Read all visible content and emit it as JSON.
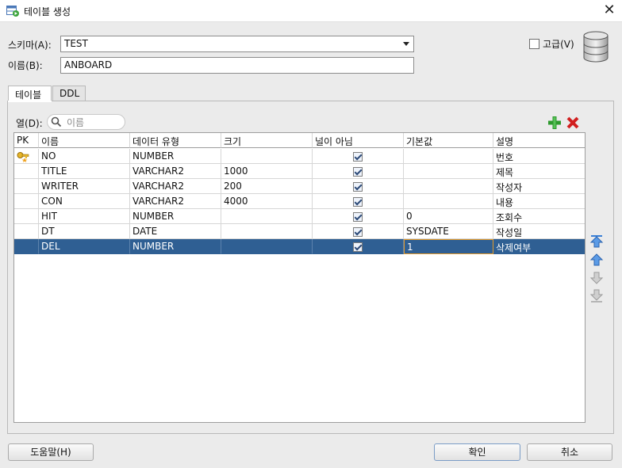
{
  "window": {
    "title": "테이블 생성",
    "close_glyph": "✕"
  },
  "schema": {
    "label": "스키마(A):",
    "value": "TEST"
  },
  "name": {
    "label": "이름(B):",
    "value": "ANBOARD"
  },
  "advanced": {
    "label": "고급(V)",
    "checked": false
  },
  "tabs": [
    {
      "label": "테이블"
    },
    {
      "label": "DDL"
    }
  ],
  "filter": {
    "label": "열(D):",
    "placeholder": "이름"
  },
  "columns": {
    "headers": [
      "PK",
      "이름",
      "데이터 유형",
      "크기",
      "널이 아님",
      "기본값",
      "설명"
    ],
    "rows": [
      {
        "pk": true,
        "name": "NO",
        "type": "NUMBER",
        "size": "",
        "not_null": true,
        "default": "",
        "comment": "번호"
      },
      {
        "pk": false,
        "name": "TITLE",
        "type": "VARCHAR2",
        "size": "1000",
        "not_null": true,
        "default": "",
        "comment": "제목"
      },
      {
        "pk": false,
        "name": "WRITER",
        "type": "VARCHAR2",
        "size": "200",
        "not_null": true,
        "default": "",
        "comment": "작성자"
      },
      {
        "pk": false,
        "name": "CON",
        "type": "VARCHAR2",
        "size": "4000",
        "not_null": true,
        "default": "",
        "comment": "내용"
      },
      {
        "pk": false,
        "name": "HIT",
        "type": "NUMBER",
        "size": "",
        "not_null": true,
        "default": "0",
        "comment": "조회수"
      },
      {
        "pk": false,
        "name": "DT",
        "type": "DATE",
        "size": "",
        "not_null": true,
        "default": "SYSDATE",
        "comment": "작성일"
      },
      {
        "pk": false,
        "name": "DEL",
        "type": "NUMBER",
        "size": "",
        "not_null": true,
        "default": "1",
        "comment": "삭제여부",
        "selected": true
      }
    ]
  },
  "buttons": {
    "help": "도움말(H)",
    "ok": "확인",
    "cancel": "취소"
  },
  "colors": {
    "selection": "#2f5f93",
    "add": "#2e9a2e",
    "delete": "#d11f1f",
    "move": "#3a7fd5"
  }
}
